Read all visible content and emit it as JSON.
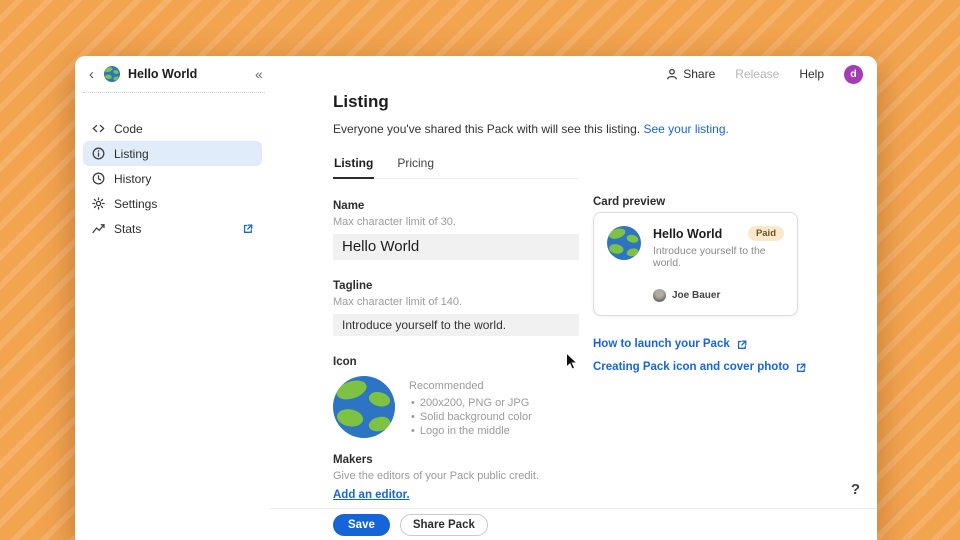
{
  "app": {
    "title": "Hello World",
    "topbar": {
      "back_icon": "‹",
      "collapse_icon": "«",
      "share_label": "Share",
      "release_label": "Release",
      "help_label": "Help",
      "avatar_initial": "d"
    },
    "sidebar": {
      "items": [
        {
          "label": "Code"
        },
        {
          "label": "Listing"
        },
        {
          "label": "History"
        },
        {
          "label": "Settings"
        },
        {
          "label": "Stats"
        }
      ]
    },
    "main": {
      "title": "Listing",
      "description": "Everyone you've shared this Pack with will see this listing.",
      "description_link": "See your listing.",
      "tabs": [
        {
          "label": "Listing"
        },
        {
          "label": "Pricing"
        }
      ],
      "name_field": {
        "label": "Name",
        "hint": "Max character limit of 30.",
        "value": "Hello World"
      },
      "tagline_field": {
        "label": "Tagline",
        "hint": "Max character limit of 140.",
        "value": "Introduce yourself to the world."
      },
      "icon_section": {
        "label": "Icon",
        "recommended": "Recommended",
        "bullets": [
          "200x200, PNG or JPG",
          "Solid background color",
          "Logo in the middle"
        ]
      },
      "makers_section": {
        "label": "Makers",
        "hint": "Give the editors of your Pack public credit.",
        "link": "Add an editor."
      }
    },
    "card_preview": {
      "label": "Card preview",
      "title": "Hello World",
      "badge": "Paid",
      "tagline": "Introduce yourself to the world.",
      "author": "Joe Bauer"
    },
    "links": [
      {
        "label": "How to launch your Pack"
      },
      {
        "label": "Creating Pack icon and cover photo"
      }
    ],
    "footer": {
      "save_label": "Save",
      "share_pack_label": "Share Pack",
      "help_glyph": "?"
    }
  },
  "colors": {
    "accent_blue": "#1766d6",
    "save_blue": "#1565d8",
    "badge_bg": "#faeacb",
    "badge_text": "#6e5520",
    "selected_item_bg": "#e1ecfa",
    "avatar_purple": "#a33cb5",
    "background_orange": "#f3a44f"
  },
  "icons": [
    "globe-icon",
    "code-icon",
    "info-icon",
    "clock-icon",
    "gear-icon",
    "trend-icon",
    "external-link-icon",
    "person-icon",
    "back-chevron-icon",
    "collapse-sidebar-icon",
    "mouse-cursor"
  ]
}
